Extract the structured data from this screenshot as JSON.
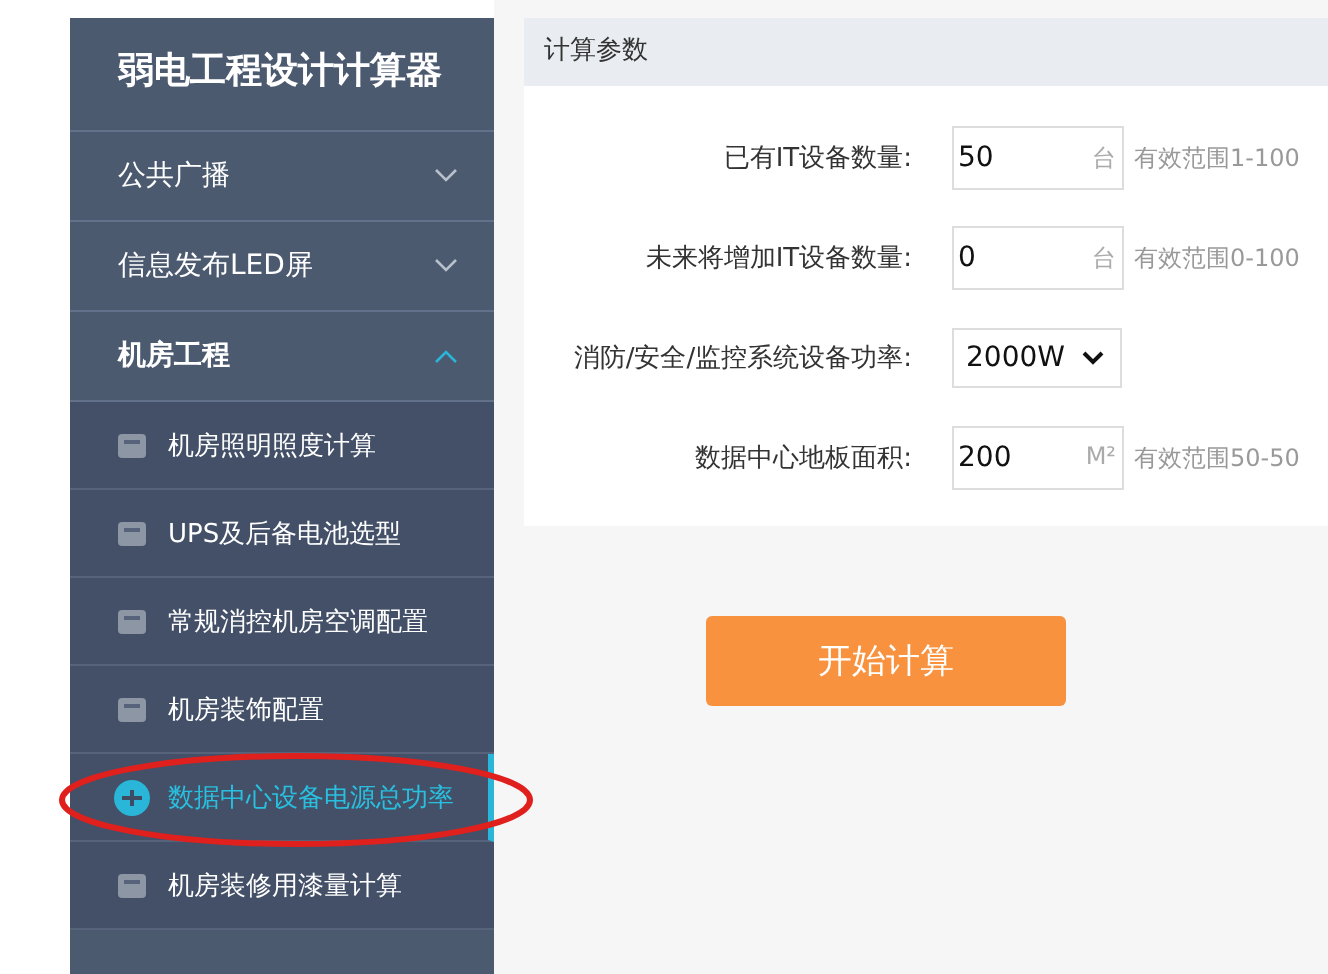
{
  "sidebar": {
    "title": "弱电工程设计计算器",
    "groups": [
      {
        "label": "公共广播",
        "expanded": false
      },
      {
        "label": "信息发布LED屏",
        "expanded": false
      },
      {
        "label": "机房工程",
        "expanded": true,
        "children": [
          {
            "label": "机房照明照度计算",
            "selected": false
          },
          {
            "label": "UPS及后备电池选型",
            "selected": false
          },
          {
            "label": "常规消控机房空调配置",
            "selected": false
          },
          {
            "label": "机房装饰配置",
            "selected": false
          },
          {
            "label": "数据中心设备电源总功率",
            "selected": true
          },
          {
            "label": "机房装修用漆量计算",
            "selected": false
          }
        ]
      }
    ]
  },
  "panel": {
    "title": "计算参数",
    "fields": [
      {
        "kind": "input",
        "label": "已有IT设备数量:",
        "value": "50",
        "unit": "台",
        "hint": "有效范围1-100"
      },
      {
        "kind": "input",
        "label": "未来将增加IT设备数量:",
        "value": "0",
        "unit": "台",
        "hint": "有效范围0-100"
      },
      {
        "kind": "select",
        "label": "消防/安全/监控系统设备功率:",
        "value": "2000W"
      },
      {
        "kind": "input",
        "label": "数据中心地板面积:",
        "value": "200",
        "unit": "M²",
        "hint": "有效范围50-50"
      }
    ]
  },
  "submit_button": "开始计算"
}
